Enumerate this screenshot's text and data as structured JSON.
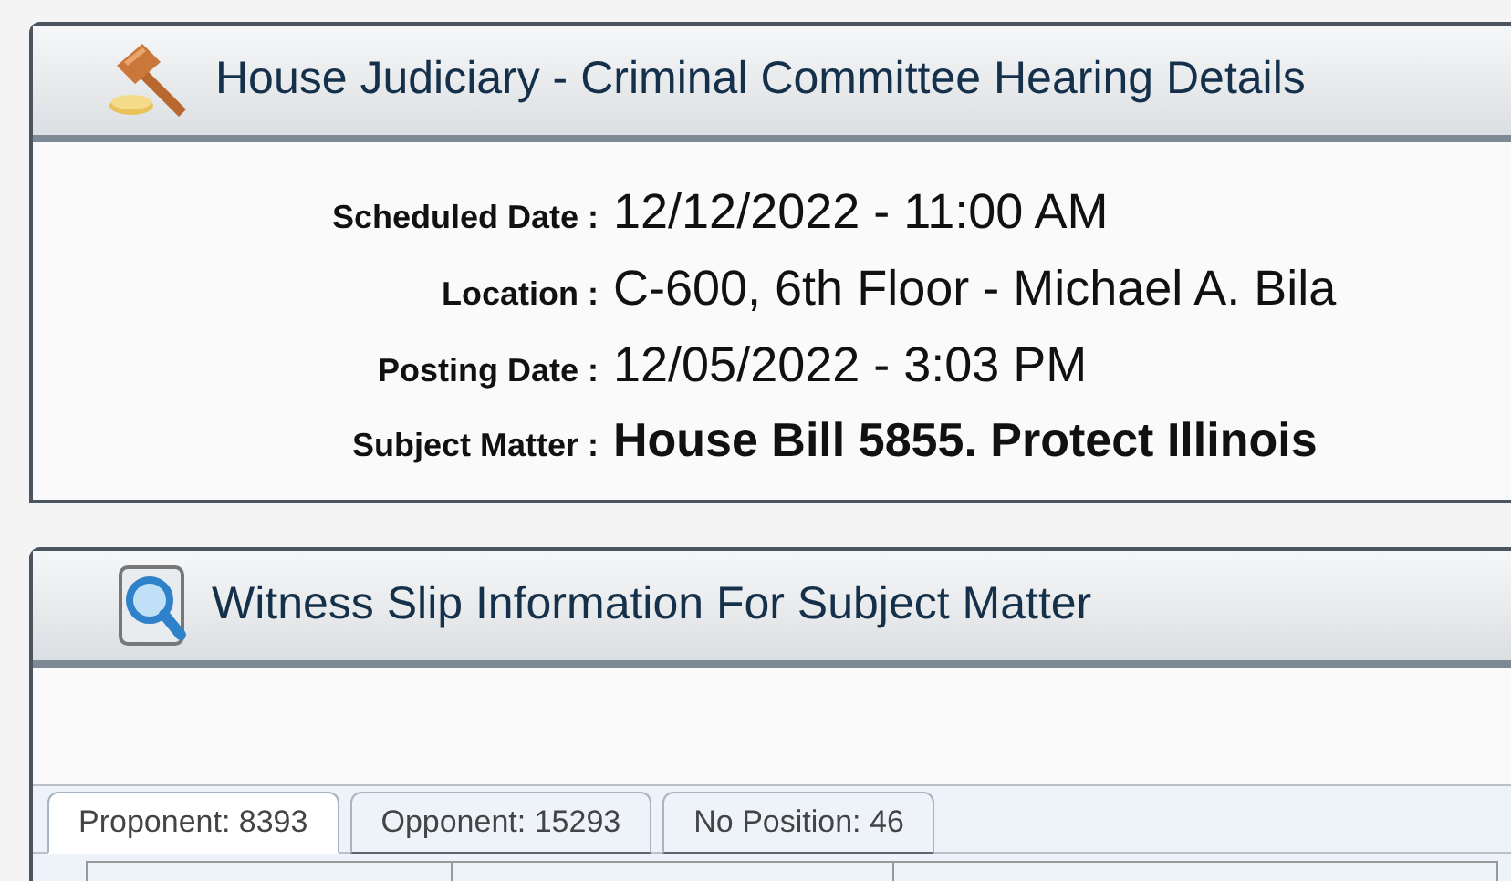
{
  "hearing_panel": {
    "title": "House Judiciary - Criminal Committee Hearing Details",
    "fields": [
      {
        "label": "Scheduled Date :",
        "value": "12/12/2022 - 11:00 AM",
        "kind": "plain"
      },
      {
        "label": "Location :",
        "value": "C-600, 6th Floor - Michael A. Bila",
        "kind": "plain"
      },
      {
        "label": "Posting Date :",
        "value": "12/05/2022 - 3:03 PM",
        "kind": "plain"
      },
      {
        "label": "Subject Matter :",
        "value": "House Bill 5855. Protect Illinois",
        "kind": "bold"
      }
    ]
  },
  "witness_panel": {
    "title": "Witness Slip Information For Subject Matter",
    "tabs": [
      {
        "label": "Proponent: 8393",
        "selected": true
      },
      {
        "label": "Opponent: 15293",
        "selected": false
      },
      {
        "label": "No Position: 46",
        "selected": false
      }
    ]
  }
}
